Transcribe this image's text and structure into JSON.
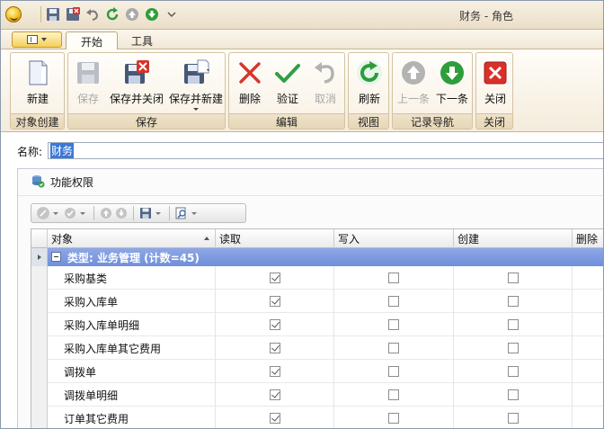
{
  "window": {
    "title": "财务 - 角色"
  },
  "tabs": [
    {
      "label": "开始",
      "active": true
    },
    {
      "label": "工具",
      "active": false
    }
  ],
  "ribbon": {
    "groups": [
      {
        "label": "对象创建",
        "buttons": [
          {
            "label": "新建",
            "enabled": true,
            "icon": "new-document-icon"
          }
        ]
      },
      {
        "label": "保存",
        "buttons": [
          {
            "label": "保存",
            "enabled": false,
            "icon": "save-icon"
          },
          {
            "label": "保存并关闭",
            "enabled": true,
            "icon": "save-close-icon"
          },
          {
            "label": "保存并新建",
            "enabled": true,
            "icon": "save-new-icon"
          }
        ]
      },
      {
        "label": "编辑",
        "buttons": [
          {
            "label": "删除",
            "enabled": true,
            "icon": "delete-icon"
          },
          {
            "label": "验证",
            "enabled": true,
            "icon": "validate-check-icon"
          },
          {
            "label": "取消",
            "enabled": false,
            "icon": "undo-icon"
          }
        ]
      },
      {
        "label": "视图",
        "buttons": [
          {
            "label": "刷新",
            "enabled": true,
            "icon": "refresh-icon"
          }
        ]
      },
      {
        "label": "记录导航",
        "buttons": [
          {
            "label": "上一条",
            "enabled": false,
            "icon": "arrow-up-icon"
          },
          {
            "label": "下一条",
            "enabled": true,
            "icon": "arrow-down-icon"
          }
        ]
      },
      {
        "label": "关闭",
        "buttons": [
          {
            "label": "关闭",
            "enabled": true,
            "icon": "close-icon"
          }
        ]
      }
    ]
  },
  "form": {
    "name_label": "名称:",
    "name_value": "财务"
  },
  "panel": {
    "title": "功能权限"
  },
  "grid": {
    "columns": [
      "对象",
      "读取",
      "写入",
      "创建",
      "删除"
    ],
    "group_label": "类型: 业务管理 (计数=45)",
    "rows": [
      {
        "object": "采购基类",
        "read": true,
        "write": false,
        "create": false
      },
      {
        "object": "采购入库单",
        "read": true,
        "write": false,
        "create": false
      },
      {
        "object": "采购入库单明细",
        "read": true,
        "write": false,
        "create": false
      },
      {
        "object": "采购入库单其它费用",
        "read": true,
        "write": false,
        "create": false
      },
      {
        "object": "调拨单",
        "read": true,
        "write": false,
        "create": false
      },
      {
        "object": "调拨单明细",
        "read": true,
        "write": false,
        "create": false
      },
      {
        "object": "订单其它费用",
        "read": true,
        "write": false,
        "create": false
      }
    ]
  },
  "colors": {
    "group_row": "#7c99e0",
    "ribbon_bg": "#f8f0e2",
    "selection": "#3c78d8"
  }
}
